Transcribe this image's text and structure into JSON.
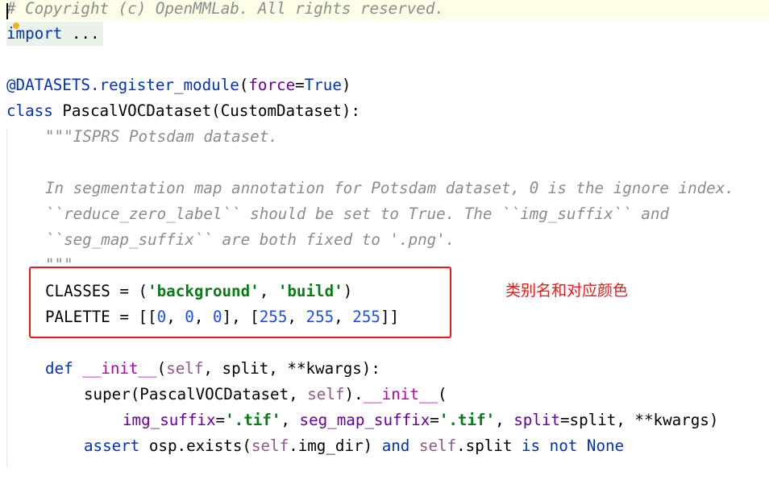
{
  "editor": {
    "comment_line": "# Copyright (c) OpenMMLab. All rights reserved.",
    "import_kw": "import",
    "import_rest": " ...",
    "decorator": "@DATASETS.register_module",
    "decorator_paren_open": "(",
    "decorator_param": "force",
    "decorator_eq": "=",
    "decorator_value": "True",
    "decorator_paren_close": ")",
    "class_kw": "class",
    "class_rest": " PascalVOCDataset(CustomDataset):",
    "doc1": "\"\"\"ISPRS Potsdam dataset.",
    "doc2": "In segmentation map annotation for Potsdam dataset, 0 is the ignore index.",
    "doc3": "``reduce_zero_label`` should be set to True. The ``img_suffix`` and",
    "doc4": "``seg_map_suffix`` are both fixed to '.png'.",
    "doc5": "\"\"\"",
    "classes_prefix": "CLASSES = (",
    "classes_str1": "'background'",
    "classes_sep": ", ",
    "classes_str2": "'build'",
    "classes_suffix": ")",
    "palette_prefix": "PALETTE = [[",
    "palette_n1": "0",
    "palette_n2": "0",
    "palette_n3": "0",
    "palette_mid": "], [",
    "palette_n4": "255",
    "palette_n5": "255",
    "palette_n6": "255",
    "palette_suffix": "]]",
    "comma": ", ",
    "def_kw": "def",
    "init_name": "__init__",
    "def_paren": "(",
    "self": "self",
    "def_rest": ", split, **kwargs):",
    "super_prefix": "super(PascalVOCDataset, ",
    "super_mid": ").",
    "super_paren": "(",
    "img_suffix_param": "img_suffix",
    "eq": "=",
    "tif_str": "'.tif'",
    "seg_map_suffix_param": "seg_map_suffix",
    "split_param": "split",
    "split_rest": "=split, **kwargs)",
    "assert_kw": "assert",
    "assert_mid": " osp.exists(",
    "assert_mid2": ".img_dir) ",
    "and_kw": "and",
    "space": " ",
    "assert_split": ".split ",
    "is_kw": "is",
    "not_kw": "not",
    "none_kw": "None"
  },
  "annotation": {
    "text": "类别名和对应颜色",
    "color": "#e8191a"
  },
  "colors": {
    "keyword": "#0033b3",
    "string": "#067d17",
    "number": "#1750eb",
    "comment": "#8c8c8c",
    "decorator": "#9e880d",
    "self": "#94558d",
    "param": "#660099"
  }
}
